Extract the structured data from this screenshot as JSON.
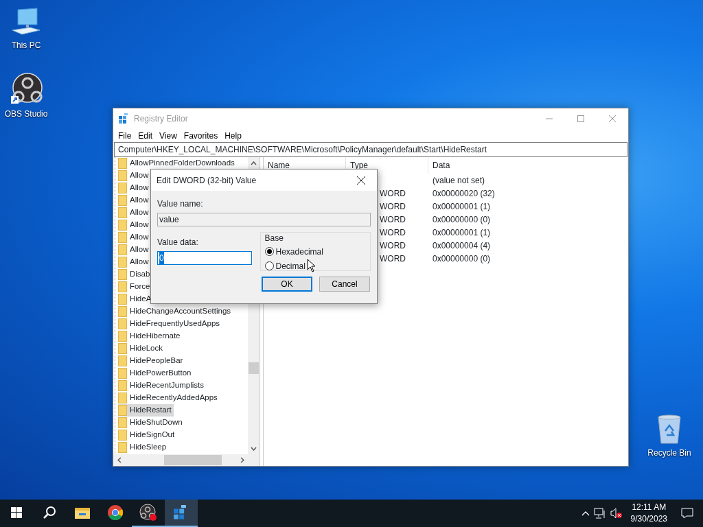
{
  "desktop_icons": [
    {
      "label": "This PC",
      "kind": "pc"
    },
    {
      "label": "OBS Studio",
      "kind": "obs"
    },
    {
      "label": "Recycle Bin",
      "kind": "bin"
    }
  ],
  "window": {
    "title": "Registry Editor",
    "active": false,
    "menu": [
      "File",
      "Edit",
      "View",
      "Favorites",
      "Help"
    ],
    "address": "Computer\\HKEY_LOCAL_MACHINE\\SOFTWARE\\Microsoft\\PolicyManager\\default\\Start\\HideRestart",
    "tree": [
      {
        "label": "AllowPinnedFolderDownloads",
        "selected": false
      },
      {
        "label": "Allow",
        "selected": false
      },
      {
        "label": "Allow",
        "selected": false
      },
      {
        "label": "Allow",
        "selected": false
      },
      {
        "label": "Allow",
        "selected": false
      },
      {
        "label": "Allow",
        "selected": false
      },
      {
        "label": "Allow",
        "selected": false
      },
      {
        "label": "Allow",
        "selected": false
      },
      {
        "label": "Allow",
        "selected": false
      },
      {
        "label": "Disab",
        "selected": false
      },
      {
        "label": "Force",
        "selected": false
      },
      {
        "label": "HideA",
        "selected": false
      },
      {
        "label": "HideChangeAccountSettings",
        "selected": false
      },
      {
        "label": "HideFrequentlyUsedApps",
        "selected": false
      },
      {
        "label": "HideHibernate",
        "selected": false
      },
      {
        "label": "HideLock",
        "selected": false
      },
      {
        "label": "HidePeopleBar",
        "selected": false
      },
      {
        "label": "HidePowerButton",
        "selected": false
      },
      {
        "label": "HideRecentJumplists",
        "selected": false
      },
      {
        "label": "HideRecentlyAddedApps",
        "selected": false
      },
      {
        "label": "HideRestart",
        "selected": true
      },
      {
        "label": "HideShutDown",
        "selected": false
      },
      {
        "label": "HideSignOut",
        "selected": false
      },
      {
        "label": "HideSleep",
        "selected": false
      }
    ],
    "columns": [
      "Name",
      "Type",
      "Data"
    ],
    "rows": [
      {
        "data": "(value not set)"
      },
      {
        "type": "WORD",
        "data": "0x00000020 (32)"
      },
      {
        "type": "WORD",
        "data": "0x00000001 (1)"
      },
      {
        "type": "WORD",
        "data": "0x00000000 (0)"
      },
      {
        "type": "WORD",
        "data": "0x00000001 (1)"
      },
      {
        "type": "WORD",
        "data": "0x00000004 (4)"
      },
      {
        "type": "WORD",
        "data": "0x00000000 (0)"
      }
    ]
  },
  "dialog": {
    "title": "Edit DWORD (32-bit) Value",
    "value_name_label": "Value name:",
    "value_name": "value",
    "value_data_label": "Value data:",
    "value_data": "0",
    "base_label": "Base",
    "bases": [
      {
        "label": "Hexadecimal",
        "selected": true
      },
      {
        "label": "Decimal",
        "selected": false
      }
    ],
    "buttons": [
      {
        "label": "OK",
        "default": true
      },
      {
        "label": "Cancel",
        "default": false
      }
    ]
  },
  "taskbar": {
    "apps": [
      {
        "kind": "start",
        "running": false,
        "active": false
      },
      {
        "kind": "search",
        "running": false,
        "active": false
      },
      {
        "kind": "explorer",
        "running": false,
        "active": false
      },
      {
        "kind": "chrome",
        "running": false,
        "active": false
      },
      {
        "kind": "obs",
        "running": true,
        "active": false
      },
      {
        "kind": "regedit",
        "running": true,
        "active": true
      }
    ],
    "time": "12:11 AM",
    "date": "9/30/2023"
  }
}
